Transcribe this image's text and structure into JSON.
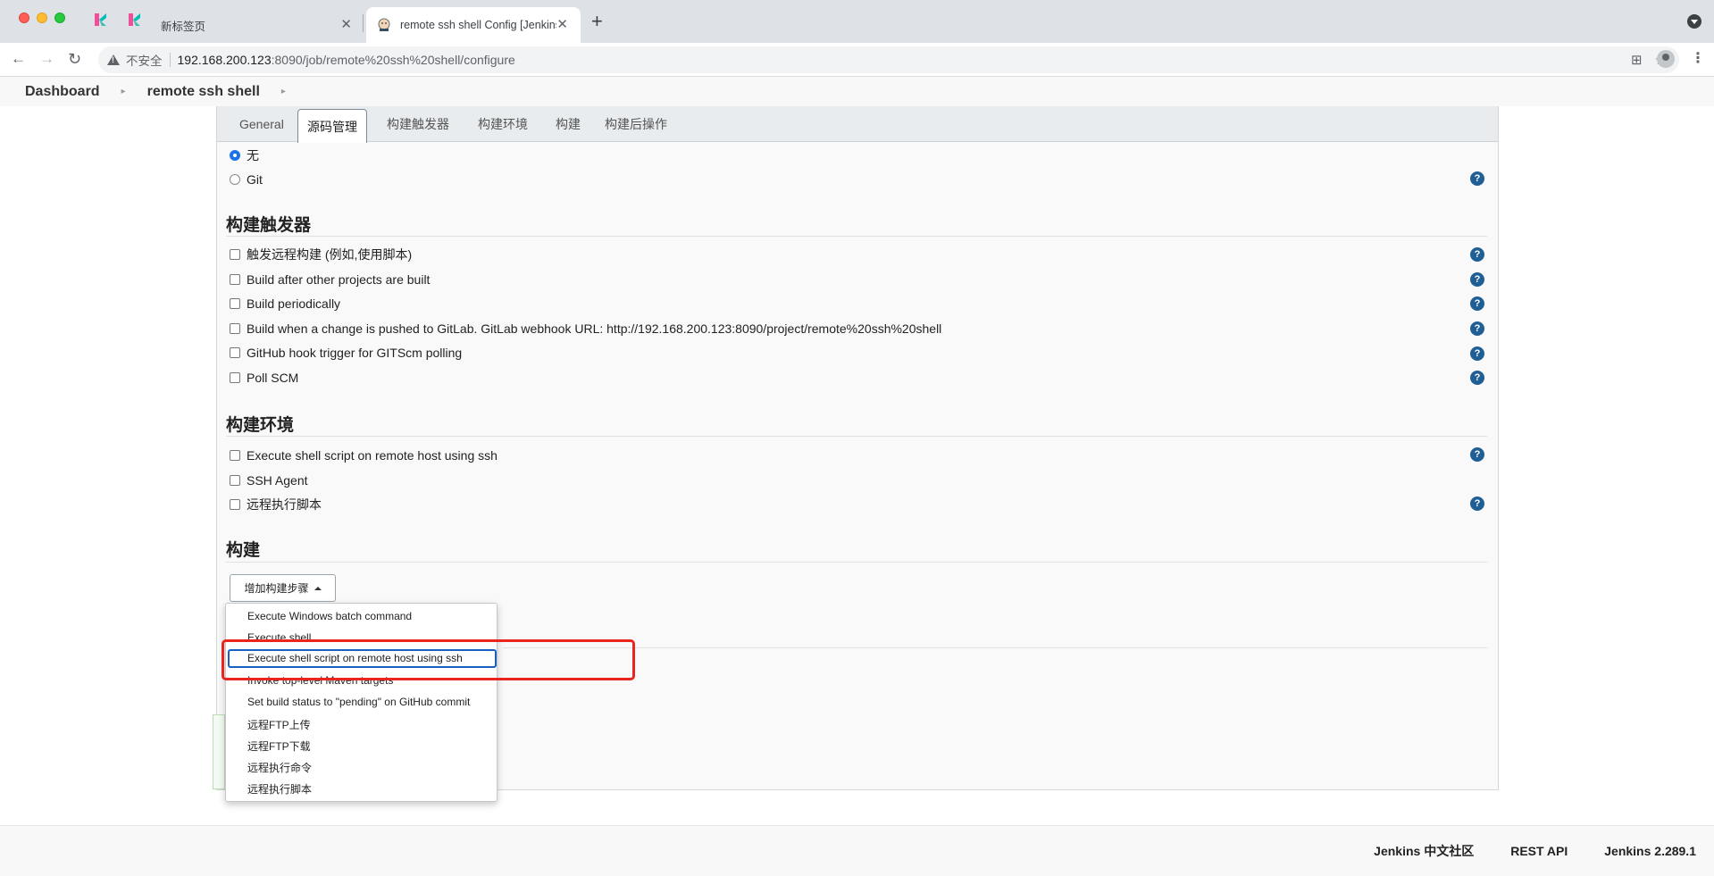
{
  "browser": {
    "tabs": [
      {
        "title": "新标签页",
        "active": false
      },
      {
        "title": "remote ssh shell Config [Jenkins]",
        "active": true
      }
    ],
    "new_tab": "+",
    "address": {
      "insecure_label": "不安全",
      "host": "192.168.200.123",
      "rest": ":8090/job/remote%20ssh%20shell/configure"
    }
  },
  "breadcrumbs": [
    "Dashboard",
    "remote ssh shell"
  ],
  "config_tabs": [
    "General",
    "源码管理",
    "构建触发器",
    "构建环境",
    "构建",
    "构建后操作"
  ],
  "active_tab": "源码管理",
  "scm": {
    "options": [
      {
        "label": "无",
        "selected": true
      },
      {
        "label": "Git",
        "selected": false
      }
    ]
  },
  "triggers": {
    "title": "构建触发器",
    "options": [
      "触发远程构建 (例如,使用脚本)",
      "Build after other projects are built",
      "Build periodically",
      "Build when a change is pushed to GitLab. GitLab webhook URL: http://192.168.200.123:8090/project/remote%20ssh%20shell",
      "GitHub hook trigger for GITScm polling",
      "Poll SCM"
    ]
  },
  "build_env": {
    "title": "构建环境",
    "options": [
      "Execute shell script on remote host using ssh",
      "SSH Agent",
      "远程执行脚本"
    ]
  },
  "build": {
    "title": "构建",
    "add_step_label": "增加构建步骤",
    "menu_items": [
      "Execute Windows batch command",
      "Execute shell",
      "Execute shell script on remote host using ssh",
      "Invoke top-level Maven targets",
      "Set build status to \"pending\" on GitHub commit",
      "远程FTP上传",
      "远程FTP下载",
      "远程执行命令",
      "远程执行脚本"
    ],
    "focused_item": "Execute shell script on remote host using ssh"
  },
  "help_label": "?",
  "footer": [
    "Jenkins 中文社区",
    "REST API",
    "Jenkins 2.289.1"
  ],
  "colors": {
    "highlight": "#e8261f",
    "help_icon": "#1f5f95",
    "focus_ring": "#1a5fc2"
  },
  "icons": [
    "back-icon",
    "forward-icon",
    "reload-icon",
    "warning-icon",
    "translate-icon",
    "star-icon",
    "profile-icon",
    "menu-icon",
    "help-icon",
    "caret-up-icon"
  ]
}
